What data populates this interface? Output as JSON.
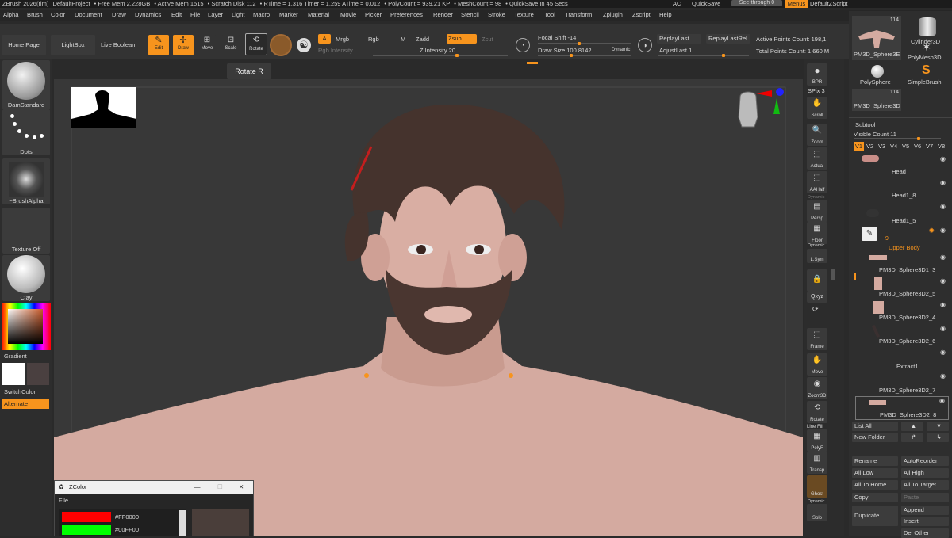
{
  "title": [
    "ZBrush 2026(rlm)",
    "DefaultProject",
    "• Free Mem 2.228GB",
    "• Active Mem 1515",
    "• Scratch Disk 112",
    "• RTime = 1.316 Timer = 1.259 ATime = 0.012",
    "• PolyCount = 939.21 KP",
    "• MeshCount = 98",
    "• QuickSave In 45 Secs"
  ],
  "title_right": {
    "ac": "AC",
    "quicksave": "QuickSave",
    "seethrough": "See-through",
    "seethrough_val": "0",
    "menus": "Menus",
    "script": "DefaultZScript"
  },
  "menus": [
    "Alpha",
    "Brush",
    "Color",
    "Document",
    "Draw",
    "Dynamics",
    "Edit",
    "File",
    "Layer",
    "Light",
    "Macro",
    "Marker",
    "Material",
    "Movie",
    "Picker",
    "Preferences",
    "Render",
    "Stencil",
    "Stroke",
    "Texture",
    "Tool",
    "Transform",
    "Zplugin",
    "Zscript",
    "Help"
  ],
  "toolbar": {
    "home": "Home Page",
    "lightbox": "LightBox",
    "liveboolean": "Live Boolean",
    "edit": "Edit",
    "draw": "Draw",
    "move": "Move",
    "scale": "Scale",
    "rotate": "Rotate",
    "a": "A",
    "mrgb": "Mrgb",
    "rgb": "Rgb",
    "m": "M",
    "zadd": "Zadd",
    "zsub": "Zsub",
    "zcut": "Zcut",
    "rgb_intensity": "Rgb Intensity",
    "z_intensity": "Z Intensity 20",
    "focal_shift": "Focal Shift -14",
    "draw_size": "Draw Size 100.8142",
    "dynamic": "Dynamic",
    "replay_last": "ReplayLast",
    "replay_last_rel": "ReplayLastRel",
    "adjust_last": "AdjustLast 1",
    "active_points": "Active Points Count: 198,1",
    "total_points": "Total Points Count: 1.660 M",
    "tooltip": "Rotate  R"
  },
  "left": {
    "brush": "DamStandard",
    "stroke": "Dots",
    "alpha": "~BrushAlpha",
    "texture": "Texture Off",
    "material": "Clay",
    "gradient": "Gradient",
    "switchcolor": "SwitchColor",
    "alternate": "Alternate"
  },
  "right_strip": [
    "BPR",
    "SPix 3",
    "Scroll",
    "Zoom",
    "Actual",
    "AAHalf",
    "Persp",
    "Floor",
    "L.Sym",
    "Qxyz",
    "Frame",
    "Move",
    "Zoom3D",
    "Rotate",
    "PolyF",
    "Transp",
    "Ghost",
    "Solo"
  ],
  "right_strip_extra": {
    "dynamic": "Dynamic",
    "line_fill": "Line Fill"
  },
  "tool_panel": {
    "thumb_count_1": "114",
    "thumb_count_2": "114",
    "tools": [
      "PM3D_Sphere3E",
      "Cylinder3D",
      "PolySphere",
      "PolyMesh3D",
      "SimpleBrush",
      "PM3D_Sphere3D"
    ],
    "subtool": "Subtool",
    "visible_count": "Visible Count 11",
    "versions": [
      "V1",
      "V2",
      "V3",
      "V4",
      "V5",
      "V6",
      "V7",
      "V8"
    ],
    "items": [
      "Head",
      "Head1_8",
      "Head1_5",
      "Upper Body",
      "PM3D_Sphere3D1_3",
      "PM3D_Sphere3D2_5",
      "PM3D_Sphere3D2_4",
      "PM3D_Sphere3D2_6",
      "Extract1",
      "PM3D_Sphere3D2_7",
      "PM3D_Sphere3D2_8"
    ],
    "upper_body_num": "9",
    "list_all": "List All",
    "new_folder": "New Folder",
    "buttons": [
      "Rename",
      "AutoReorder",
      "All Low",
      "All High",
      "All To Home",
      "All To Target",
      "Copy",
      "Paste",
      "Duplicate",
      "Append",
      "Insert",
      "Del Other"
    ]
  },
  "zcolor": {
    "title": "ZColor",
    "menu": "File",
    "colors": [
      {
        "hex": "#FF0000",
        "label": "#FF0000"
      },
      {
        "hex": "#00FF00",
        "label": "#00FF00"
      }
    ]
  },
  "accent": "#f7941d"
}
